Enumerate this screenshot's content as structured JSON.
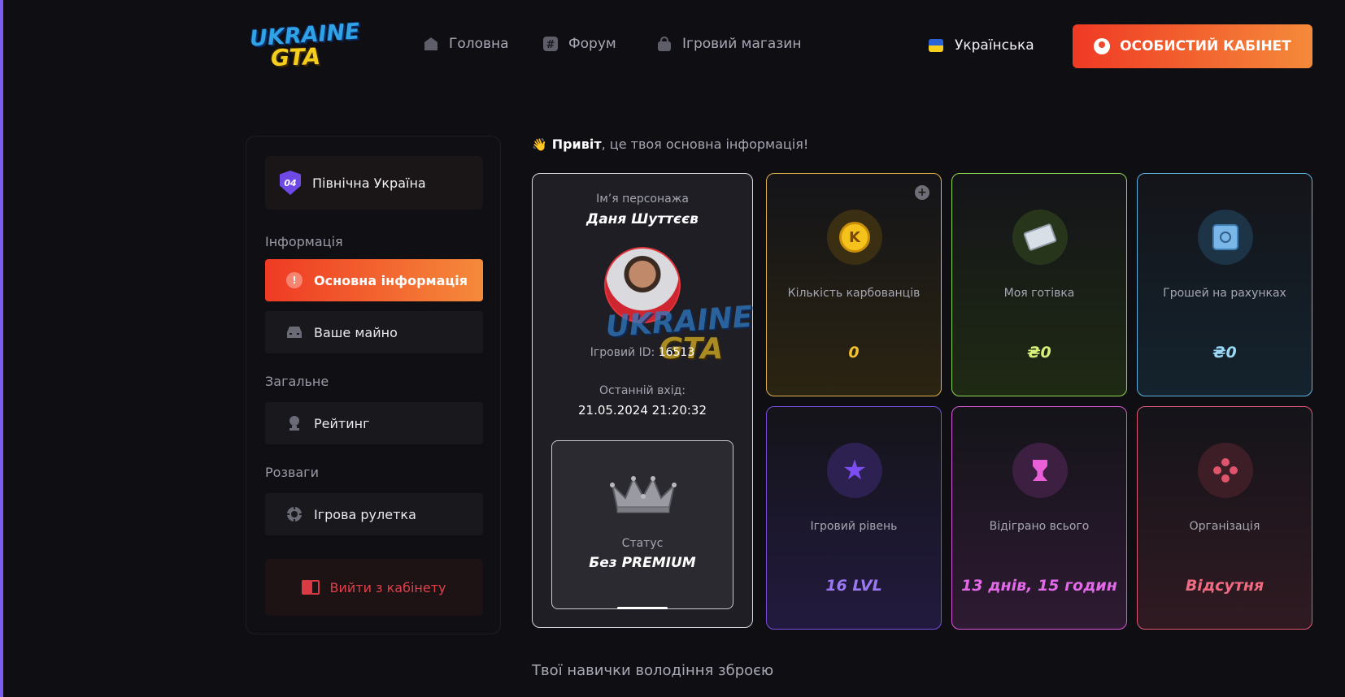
{
  "header": {
    "logo": {
      "line1": "UKRAINE",
      "line2": "GTA"
    },
    "nav": [
      {
        "label": "Головна",
        "icon": "home-icon"
      },
      {
        "label": "Форум",
        "icon": "hash-icon"
      },
      {
        "label": "Ігровий магазин",
        "icon": "shop-bag-icon"
      }
    ],
    "language": "Українська",
    "cabinet_button": "ОСОБИСТИЙ КАБІНЕТ"
  },
  "sidebar": {
    "server": {
      "badge": "04",
      "name": "Північна Україна"
    },
    "sections": [
      {
        "title": "Інформація",
        "items": [
          {
            "label": "Основна інформація",
            "active": true
          },
          {
            "label": "Ваше майно",
            "active": false
          }
        ]
      },
      {
        "title": "Загальне",
        "items": [
          {
            "label": "Рейтинг",
            "active": false
          }
        ]
      },
      {
        "title": "Розваги",
        "items": [
          {
            "label": "Ігрова рулетка",
            "active": false
          }
        ]
      }
    ],
    "logout": "Вийти з кабінету"
  },
  "main": {
    "greeting_bold": "Привіт",
    "greeting_rest": ", це твоя основна інформація!",
    "profile": {
      "name_label": "Ім’я персонажа",
      "name": "Даня Шуттєєв",
      "game_id_label": "Ігровий ID:",
      "game_id": "16513",
      "last_login_label": "Останній вхід:",
      "last_login": "21.05.2024 21:20:32",
      "status_label": "Статус",
      "status_value": "Без PREMIUM"
    },
    "stats": [
      {
        "label": "Кількість карбованців",
        "value": "0",
        "color": "#f2c12e"
      },
      {
        "label": "Моя готівка",
        "value": "₴0",
        "color": "#d6f07a"
      },
      {
        "label": "Грошей на рахунках",
        "value": "₴0",
        "color": "#9ad8f5"
      },
      {
        "label": "Ігровий рівень",
        "value": "16 LVL",
        "color": "#9a78f2"
      },
      {
        "label": "Відіграно всього",
        "value": "13 днів, 15 годин",
        "color": "#e26ae8"
      },
      {
        "label": "Організація",
        "value": "Відсутня",
        "color": "#f06a82"
      }
    ],
    "weapons_title": "Твої навички володіння зброєю"
  }
}
